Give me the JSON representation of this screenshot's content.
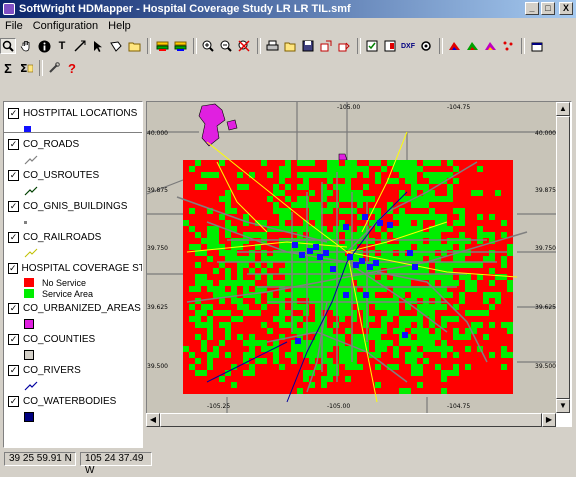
{
  "window": {
    "title": "SoftWright HDMapper - Hospital Coverage Study LR LR TIL.smf",
    "min": "_",
    "max": "□",
    "close": "X"
  },
  "menu": [
    "File",
    "Configuration",
    "Help"
  ],
  "toolbar1": [
    "search-icon",
    "pan-hand-icon",
    "info-icon",
    "text-tool-icon",
    "line-tool-icon",
    "select-arrow-icon",
    "polygon-tool-icon",
    "layer-folder-icon",
    "layer-add-icon",
    "layer-edit-icon",
    "zoom-in-icon",
    "zoom-out-icon",
    "zoom-extent-icon",
    "print-icon",
    "open-folder-icon",
    "save-icon",
    "export-icon",
    "import-icon",
    "check-icon",
    "report-icon",
    "dxf-icon",
    "gear-icon",
    "coverage-icon",
    "study-icon",
    "profile-icon",
    "point-icon",
    "window-icon"
  ],
  "toolbar1_labels": {
    "text": "T",
    "dxf": "DXF"
  },
  "toolbar2": [
    "sum-icon",
    "sum-edit-icon",
    "tools-icon",
    "help-icon"
  ],
  "toolbar2_labels": {
    "sum": "Σ",
    "help": "?"
  },
  "layers": [
    {
      "name": "HOSTPITAL LOCATIONS",
      "checked": true
    },
    {
      "name": "CO_ROADS",
      "checked": true
    },
    {
      "name": "CO_USROUTES",
      "checked": true
    },
    {
      "name": "CO_GNIS_BUILDINGS",
      "checked": true
    },
    {
      "name": "CO_RAILROADS",
      "checked": true
    },
    {
      "name": "HOSPITAL COVERAGE STUDY",
      "checked": true,
      "entries": [
        {
          "label": "No Service",
          "color": "#ff0000"
        },
        {
          "label": "Service Area",
          "color": "#00ee00"
        }
      ]
    },
    {
      "name": "CO_URBANIZED_AREAS",
      "checked": true
    },
    {
      "name": "CO_COUNTIES",
      "checked": true
    },
    {
      "name": "CO_RIVERS",
      "checked": true
    },
    {
      "name": "CO_WATERBODIES",
      "checked": true
    }
  ],
  "colors": {
    "no_service": "#ff0000",
    "service": "#00ee00",
    "hospital": "#1010ff",
    "urban": "#e020e0",
    "roads": "#808080",
    "usroutes": "#ffff00",
    "water": "#000080",
    "rivers": "#0000a0"
  },
  "map": {
    "lat_labels": [
      "40.000",
      "39.875",
      "39.750",
      "39.625",
      "39.500"
    ],
    "lon_labels_top": [
      "-105.00",
      "-104.75"
    ],
    "lon_labels_bottom": [
      "-105.25",
      "-105.00",
      "-104.75"
    ]
  },
  "status": {
    "latitude": "39 25 59.91 N",
    "longitude": "105 24 37.49 W"
  }
}
